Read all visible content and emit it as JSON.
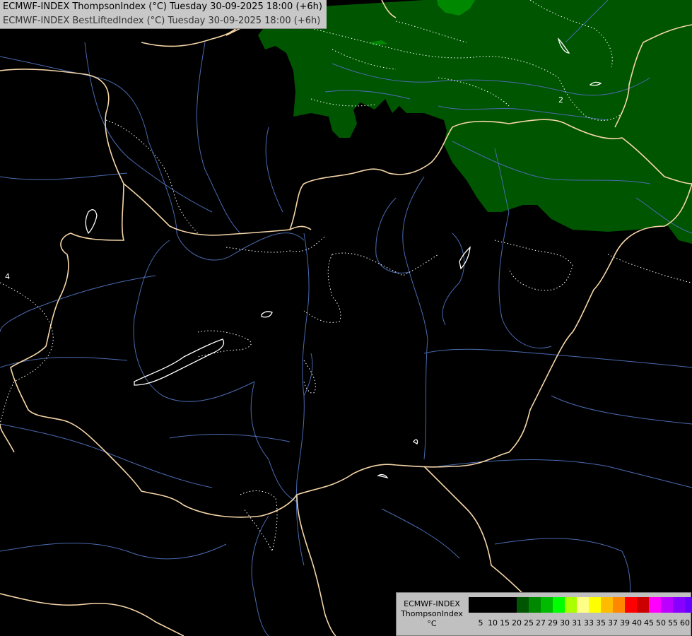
{
  "titles": {
    "line1": "ECMWF-INDEX ThompsonIndex (°C) Tuesday 30-09-2025 18:00 (+6h)",
    "line2": "ECMWF-INDEX BestLiftedIndex (°C) Tuesday 30-09-2025 18:00 (+6h)"
  },
  "legend": {
    "model": "ECMWF-INDEX",
    "parameter": "ThompsonIndex",
    "unit": "°C",
    "colors": [
      "#000000",
      "#000000",
      "#000000",
      "#000000",
      "#005500",
      "#008800",
      "#00bb00",
      "#00ff00",
      "#aaff00",
      "#ffff88",
      "#ffff00",
      "#ffbb00",
      "#ff8800",
      "#ff0000",
      "#cc0000",
      "#ff00ff",
      "#bb00ff",
      "#8800ff",
      "#6600ff",
      "#0000ff"
    ],
    "ticks": [
      "5",
      "10",
      "15",
      "20",
      "25",
      "27",
      "29",
      "30",
      "31",
      "33",
      "35",
      "37",
      "39",
      "40",
      "45",
      "50",
      "55",
      "60"
    ]
  },
  "map": {
    "field_colors": {
      "band_25_27": "#005500",
      "band_27_29": "#008800"
    },
    "contour_labels": [
      "2",
      "4"
    ],
    "border_color": "#f5d5a8",
    "river_color": "#4a6ab0",
    "contour_color": "#ffffff"
  }
}
